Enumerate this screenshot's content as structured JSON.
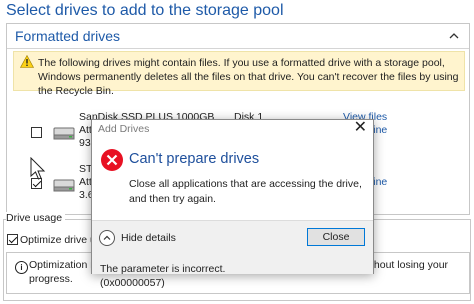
{
  "page_title": "Select drives to add to the storage pool",
  "section": {
    "title": "Formatted drives",
    "warning": "The following drives might contain files. If you use a formatted drive with a storage pool, Windows permanently deletes all the files on that drive. You can't recover the files by using the Recycle Bin."
  },
  "drives": [
    {
      "name": "SanDisk SSD PLUS 1000GB",
      "disk": "Disk 1",
      "line2": "Att",
      "line3": "931",
      "link1": "View files",
      "link2": "fline",
      "checked": false
    },
    {
      "name": "ST4",
      "line2": "Att",
      "line3": "3.6",
      "link2": "fline",
      "checked": true
    }
  ],
  "drive_usage": {
    "label": "Drive usage",
    "option": "Optimize drive us",
    "info_line1_left": "Optimization m",
    "info_line1_right": "thout losing your",
    "info_line2": "progress."
  },
  "dialog": {
    "title": "Add Drives",
    "close_glyph": "✕",
    "heading": "Can't prepare drives",
    "message": "Close all applications that are accessing the drive, and then try again.",
    "hide_details": "Hide details",
    "close_button": "Close",
    "details_line1": "The parameter is incorrect.",
    "details_line2": "(0x00000057)"
  },
  "colors": {
    "accent_blue": "#1e5aa8",
    "warning_bg": "#fff4ce",
    "error_red": "#e81123"
  }
}
